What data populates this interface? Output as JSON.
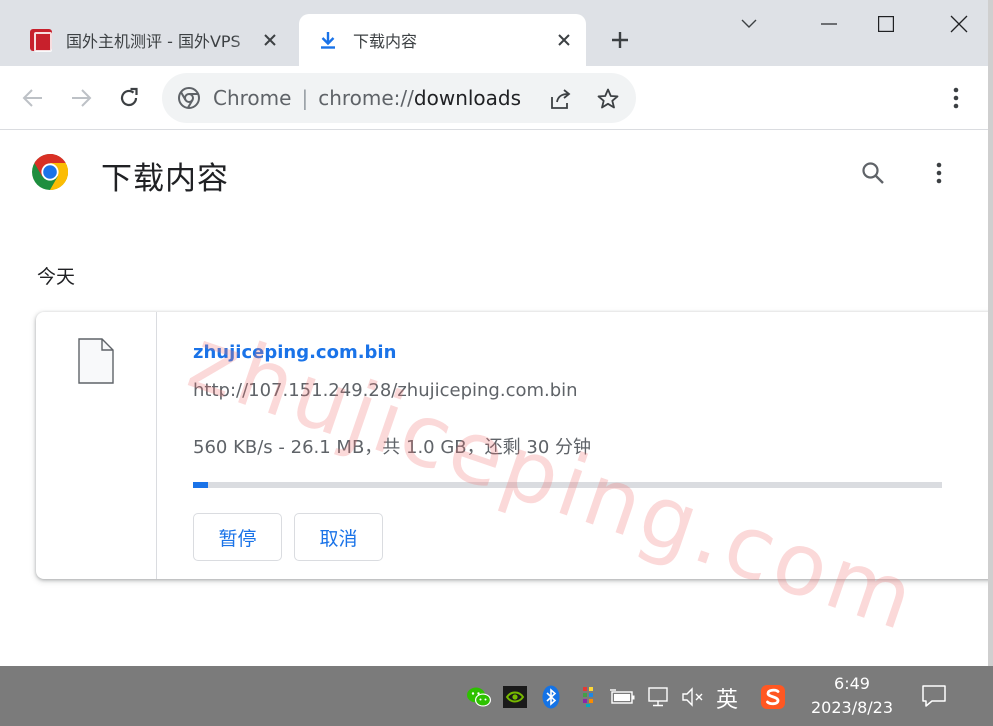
{
  "tabs": [
    {
      "title": "国外主机测评 - 国外VPS",
      "favicon": "site-favicon",
      "active": false
    },
    {
      "title": "下载内容",
      "favicon": "download-icon",
      "active": true
    }
  ],
  "window_controls": {
    "tab_search": "chevron-down-icon",
    "minimize": "minimize-icon",
    "maximize": "maximize-icon",
    "close": "close-icon"
  },
  "toolbar": {
    "site_label": "Chrome",
    "separator": "|",
    "url_scheme": "chrome://",
    "url_path": "downloads"
  },
  "page": {
    "title": "下载内容",
    "date_header": "今天"
  },
  "download": {
    "file_name": "zhujiceping.com.bin",
    "url": "http://107.151.249.28/zhujiceping.com.bin",
    "status": "560 KB/s - 26.1 MB，共 1.0 GB，还剩 30 分钟",
    "progress": 0.02,
    "pause_label": "暂停",
    "cancel_label": "取消"
  },
  "watermark": "zhujiceping.com",
  "taskbar": {
    "ime_label": "英",
    "time": "6:49",
    "date": "2023/8/23",
    "tray_icons": [
      "wechat-icon",
      "nvidia-icon",
      "bluetooth-icon",
      "color-grid-icon",
      "battery-icon",
      "network-icon",
      "volume-muted-icon",
      "sogou-icon"
    ]
  },
  "colors": {
    "accent": "#1a73e8",
    "tabstrip": "#dee1e6",
    "taskbar": "#7b7b7b",
    "text_primary": "#202124",
    "text_secondary": "#5f6368"
  }
}
